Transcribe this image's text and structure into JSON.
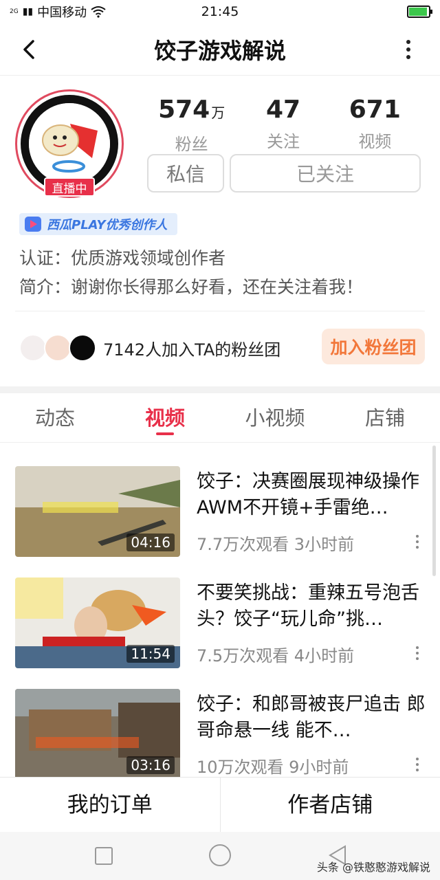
{
  "status": {
    "net": "2G",
    "carrier": "中国移动",
    "time": "21:45"
  },
  "nav": {
    "title": "饺子游戏解说"
  },
  "profile": {
    "live_badge": "直播中",
    "stats": [
      {
        "value": "574",
        "unit": "万",
        "label": "粉丝"
      },
      {
        "value": "47",
        "unit": "",
        "label": "关注"
      },
      {
        "value": "671",
        "unit": "",
        "label": "视频"
      }
    ],
    "message_button": "私信",
    "follow_button": "已关注",
    "creator_badge": "西瓜PLAY优秀创作人",
    "certification": "认证：优质游戏领域创作者",
    "intro": "简介：谢谢你长得那么好看，还在关注着我！"
  },
  "fans": {
    "text": "7142人加入TA的粉丝团",
    "join_button": "加入粉丝团"
  },
  "tabs": [
    {
      "label": "动态",
      "active": false
    },
    {
      "label": "视频",
      "active": true
    },
    {
      "label": "小视频",
      "active": false
    },
    {
      "label": "店铺",
      "active": false
    }
  ],
  "videos": [
    {
      "title": "饺子：决赛圈展现神级操作 AWM不开镜+手雷绝…",
      "meta": "7.7万次观看  3小时前",
      "duration": "04:16"
    },
    {
      "title": "不要笑挑战：重辣五号泡舌头？饺子“玩儿命”挑…",
      "meta": "7.5万次观看  4小时前",
      "duration": "11:54"
    },
    {
      "title": "饺子：和郎哥被丧尸追击 郎哥命悬一线 能不…",
      "meta": "10万次观看  9小时前",
      "duration": "03:16"
    }
  ],
  "bottom": {
    "orders": "我的订单",
    "shop": "作者店铺"
  },
  "watermark": "头条 @铁憨憨游戏解说"
}
